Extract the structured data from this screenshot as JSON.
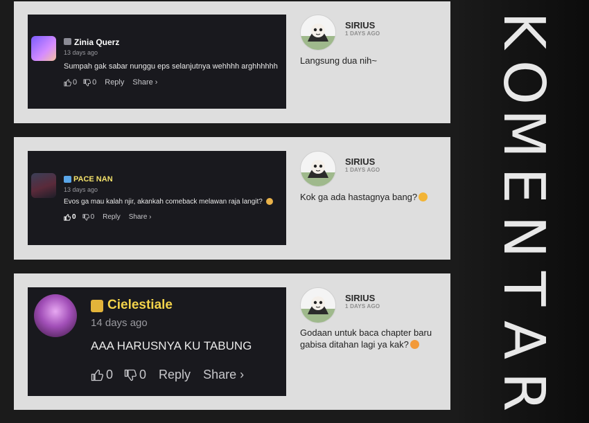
{
  "side_title": "KOMENTAR",
  "side_letters": [
    "K",
    "O",
    "M",
    "E",
    "N",
    "T",
    "A",
    "R"
  ],
  "comments": [
    {
      "screenshot": {
        "prefix_icon": "film-icon",
        "username": "Zinia Querz",
        "time": "13 days ago",
        "text": "Sumpah gak sabar nunggu eps selanjutnya wehhhh arghhhhhh",
        "likes": "0",
        "dislikes": "0",
        "reply_label": "Reply",
        "share_label": "Share ›"
      },
      "reply": {
        "name": "SIRIUS",
        "time": "1 DAYS AGO",
        "text": "Langsung dua nih~"
      }
    },
    {
      "screenshot": {
        "prefix_icon": "drops-icon",
        "username": "PACE NAN",
        "time": "13 days ago",
        "text": "Evos ga mau kalah njir, akankah comeback melawan raja langit?",
        "likes": "0",
        "dislikes": "0",
        "reply_label": "Reply",
        "share_label": "Share ›"
      },
      "reply": {
        "name": "SIRIUS",
        "time": "1 DAYS AGO",
        "text": "Kok ga ada hastagnya bang?"
      }
    },
    {
      "screenshot": {
        "prefix_icon": "trophy-icon",
        "username": "Cielestiale",
        "time": "14 days ago",
        "text": "AAA HARUSNYA KU TABUNG",
        "likes": "0",
        "dislikes": "0",
        "reply_label": "Reply",
        "share_label": "Share ›"
      },
      "reply": {
        "name": "SIRIUS",
        "time": "1 DAYS AGO",
        "text": "Godaan untuk baca chapter baru gabisa ditahan lagi ya kak?"
      }
    }
  ],
  "colors": {
    "background": "#1b1b1b",
    "card": "#dedede",
    "screenshot_bg": "#19191e",
    "gold_name": "#f3d34a"
  }
}
